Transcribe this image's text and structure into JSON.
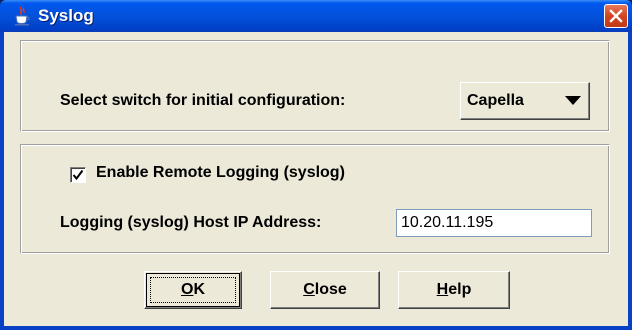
{
  "window": {
    "title": "Syslog"
  },
  "switch_select": {
    "label": "Select switch for initial configuration:",
    "value": "Capella"
  },
  "remote_logging": {
    "checkbox_label": "Enable Remote Logging (syslog)",
    "checked": true
  },
  "host_ip": {
    "label": "Logging (syslog) Host IP Address:",
    "value": "10.20.11.195"
  },
  "buttons": {
    "ok": {
      "mnemonic": "O",
      "rest": "K"
    },
    "close": {
      "mnemonic": "C",
      "rest": "lose"
    },
    "help": {
      "mnemonic": "H",
      "rest": "elp"
    }
  },
  "colors": {
    "titlebar": "#0350d8",
    "dialog_background": "#ece9d8",
    "close_button": "#d2451f"
  },
  "icons": {
    "title": "java-cup-icon",
    "close": "close-x-icon",
    "dropdown": "triangle-down-icon",
    "checkbox": "check-mark-icon"
  }
}
